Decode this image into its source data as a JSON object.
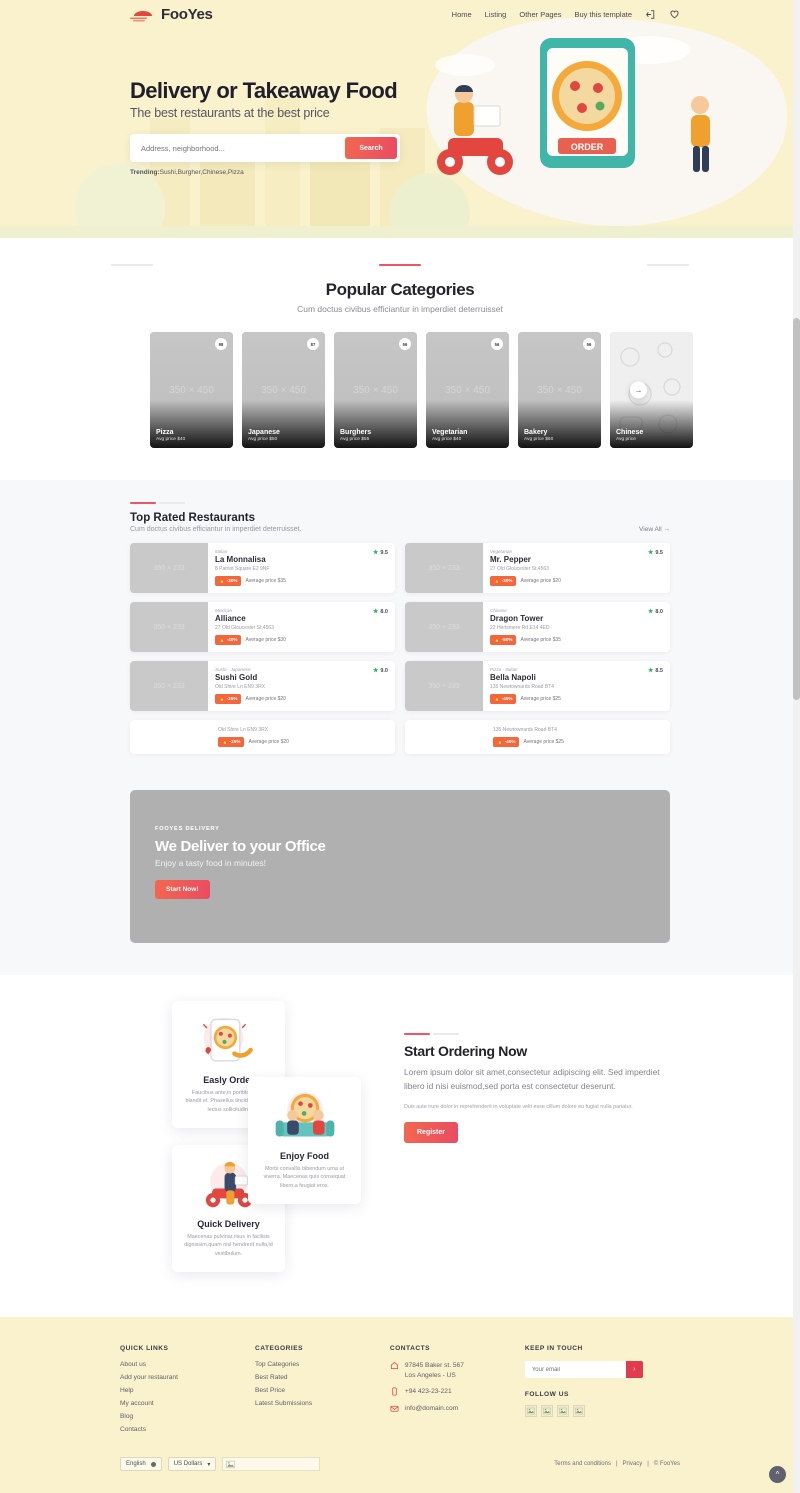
{
  "header": {
    "brand": "FooYes",
    "nav": [
      {
        "label": "Home",
        "name": "nav-home"
      },
      {
        "label": "Listing",
        "name": "nav-listing"
      },
      {
        "label": "Other Pages",
        "name": "nav-other-pages"
      },
      {
        "label": "Buy this template",
        "name": "nav-buy-template"
      }
    ],
    "login_icon": "login-icon",
    "favorite_icon": "heart-icon"
  },
  "hero": {
    "title": "Delivery or Takeaway Food",
    "subtitle": "The best restaurants at the best price",
    "search_placeholder": "Address, neighborhood...",
    "search_button": "Search",
    "trending_label": "Trending:",
    "trending_items": "Sushi,Burgher,Chinese,Pizza"
  },
  "categories": {
    "title": "Popular Categories",
    "subtitle": "Cum doctus civibus efficiantur in imperdiet deterruisset",
    "placeholder_text": "350 × 450",
    "next_icon": "arrow-right-icon",
    "items": [
      {
        "name": "Pizza",
        "price": "Avg price $40",
        "count": "98"
      },
      {
        "name": "Japanese",
        "price": "Avg price $50",
        "count": "87"
      },
      {
        "name": "Burghers",
        "price": "Avg price $55",
        "count": "56"
      },
      {
        "name": "Vegetarian",
        "price": "Avg price $40",
        "count": "56"
      },
      {
        "name": "Bakery",
        "price": "Avg price $60",
        "count": "56"
      },
      {
        "name": "Chinese",
        "price": "Avg price",
        "count": ""
      }
    ]
  },
  "top_rated": {
    "title": "Top Rated Restaurants",
    "subtitle": "Cum doctus civibus efficiantur in imperdiet deterruisset.",
    "view_all": "View All →",
    "placeholder_text": "350 × 233",
    "restaurants": [
      {
        "cuisine": "Italian",
        "name": "La Monnalisa",
        "address": "8 Patriot Square E2 9NF",
        "rating": "9.5",
        "discount": "-30%",
        "avg": "Average price $35"
      },
      {
        "cuisine": "Vegetarian",
        "name": "Mr. Pepper",
        "address": "27 Old Gloucester St,4563",
        "rating": "9.5",
        "discount": "-30%",
        "avg": "Average price $20"
      },
      {
        "cuisine": "Mexican",
        "name": "Alliance",
        "address": "27 Old Gloucester St,4563",
        "rating": "8.0",
        "discount": "-40%",
        "avg": "Average price $30"
      },
      {
        "cuisine": "Chinese",
        "name": "Dragon Tower",
        "address": "22 Hertsmere Rd E14 4ED",
        "rating": "8.0",
        "discount": "-50%",
        "avg": "Average price $35"
      },
      {
        "cuisine": "Sushi - Japanese",
        "name": "Sushi Gold",
        "address": "Old Shire Ln EN9 3RX",
        "rating": "9.0",
        "discount": "-25%",
        "avg": "Average price $20"
      },
      {
        "cuisine": "Pizza - Italian",
        "name": "Bella Napoli",
        "address": "135 Newtownards Road BT4",
        "rating": "8.5",
        "discount": "-45%",
        "avg": "Average price $25"
      }
    ],
    "overflow": [
      {
        "address": "Old Shire Ln EN9 3RX",
        "discount": "-25%",
        "avg": "Average price $20"
      },
      {
        "address": "135 Newtownards Road BT4",
        "discount": "-45%",
        "avg": "Average price $25"
      }
    ]
  },
  "delivery_banner": {
    "kicker": "FOOYES DELIVERY",
    "title": "We Deliver to your Office",
    "subtitle": "Enjoy a tasty food in minutes!",
    "button": "Start Now!"
  },
  "features": {
    "cards": [
      {
        "title": "Easly Order",
        "text": "Faucibus ante,in porttitor tellus blandit et. Phasellus tincidunt metus lectus sollicitudin.",
        "icon": "phone-order-icon"
      },
      {
        "title": "Enjoy Food",
        "text": "Morbi convallis bibendum urna ut viverra. Maecenas quis consequat libero,a feugiat eros.",
        "icon": "people-eating-icon"
      },
      {
        "title": "Quick Delivery",
        "text": "Maecenas pulvinar,risus in facilisis dignissim,quam nisl hendrerit nulla,id vestibulum.",
        "icon": "scooter-courier-icon"
      }
    ],
    "panel": {
      "title": "Start Ordering Now",
      "lead": "Lorem ipsum dolor sit amet,consectetur adipiscing elit. Sed imperdiet libero id nisi euismod,sed porta est consectetur deserunt.",
      "small": "Duis aute irure dolor in reprehenderit in voluptate velit esse cillum dolore eu fugiat nulla pariatur.",
      "button": "Register"
    }
  },
  "footer": {
    "quick_links": {
      "head": "QUICK LINKS",
      "items": [
        "About us",
        "Add your restaurant",
        "Help",
        "My account",
        "Blog",
        "Contacts"
      ]
    },
    "categories": {
      "head": "CATEGORIES",
      "items": [
        "Top Categories",
        "Best Rated",
        "Best Price",
        "Latest Submissions"
      ]
    },
    "contacts": {
      "head": "CONTACTS",
      "address": "97845 Baker st. 567\nLos Angeles - US",
      "phone": "+94 423-23-221",
      "email": "info@domain.com",
      "address_icon": "home-icon",
      "phone_icon": "mobile-icon",
      "email_icon": "envelope-icon"
    },
    "keep_in_touch": {
      "head": "KEEP IN TOUCH",
      "placeholder": "Your email",
      "submit_icon": "chevron-right-icon",
      "follow_head": "FOLLOW US",
      "social_count": 4
    },
    "bottom": {
      "language": "English",
      "currency": "US Dollars",
      "terms": "Terms and conditions",
      "privacy": "Privacy",
      "copyright": "© FooYes",
      "to_top_icon": "arrow-up-icon"
    }
  },
  "colors": {
    "cream": "#faf2cd",
    "accent": "#ea4b62",
    "orange": "#f4663c",
    "green": "#27ae60"
  }
}
